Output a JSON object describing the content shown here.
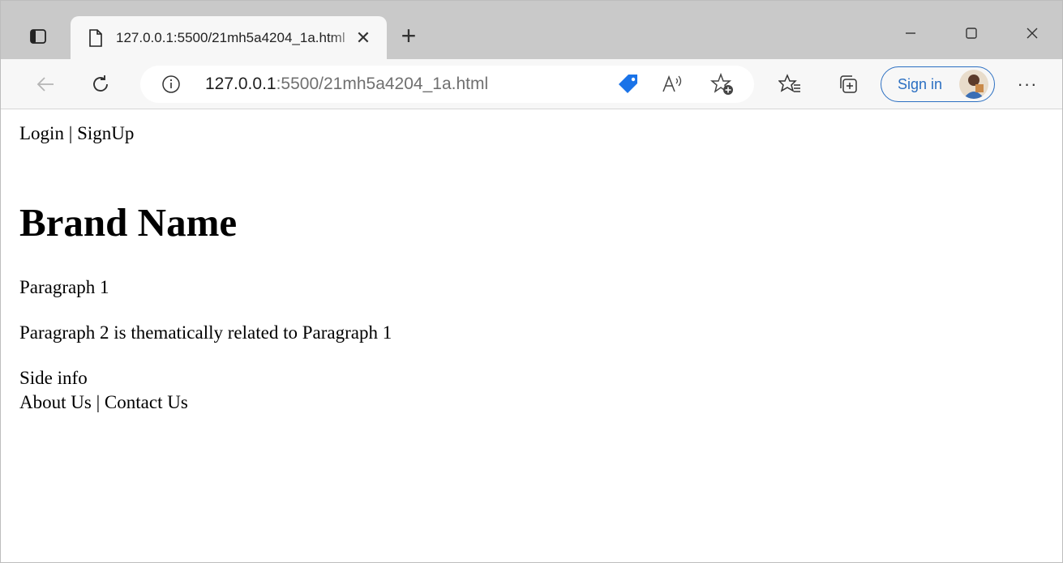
{
  "browser": {
    "tab": {
      "title": "127.0.0.1:5500/21mh5a4204_1a.html",
      "close_glyph": "✕",
      "icon": "page-icon"
    },
    "new_tab_glyph": "+",
    "window_controls": [
      "minimize-icon",
      "maximize-icon",
      "close-icon"
    ],
    "address": {
      "host": "127.0.0.1",
      "rest": ":5500/21mh5a4204_1a.html"
    },
    "signin_label": "Sign in",
    "more_glyph": "···",
    "accent_color": "#2b6fc2",
    "tag_color": "#1a73e8"
  },
  "page": {
    "nav": {
      "login": "Login",
      "separator": " | ",
      "signup": "SignUp"
    },
    "brand": "Brand Name",
    "paragraph1": "Paragraph 1",
    "paragraph2": "Paragraph 2 is thematically related to Paragraph 1",
    "side_info": "Side info",
    "footer": {
      "about": "About Us",
      "separator": " | ",
      "contact": "Contact Us"
    }
  }
}
